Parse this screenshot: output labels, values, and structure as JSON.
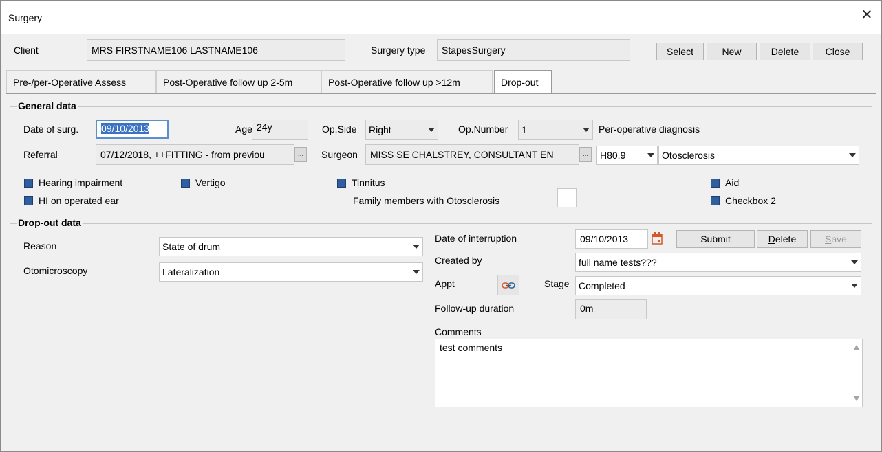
{
  "window": {
    "title": "Surgery",
    "close_glyph": "✕"
  },
  "header": {
    "client_label": "Client",
    "client_value": "MRS FIRSTNAME106 LASTNAME106",
    "surgery_type_label": "Surgery type",
    "surgery_type_value": "StapesSurgery",
    "buttons": {
      "select_pre": "Se",
      "select_u": "l",
      "select_post": "ect",
      "new_u": "N",
      "new_post": "ew",
      "delete": "Delete",
      "close": "Close"
    }
  },
  "tabs": [
    {
      "label": "Pre-/per-Operative Assess"
    },
    {
      "label": "Post-Operative follow up 2-5m"
    },
    {
      "label": "Post-Operative follow up >12m"
    },
    {
      "label": "Drop-out"
    }
  ],
  "general": {
    "title": "General data",
    "date_label": "Date of surg.",
    "date_value": "09/10/2013",
    "age_label": "Age",
    "age_value": "24y",
    "op_side_label": "Op.Side",
    "op_side_value": "Right",
    "op_number_label": "Op.Number",
    "op_number_value": "1",
    "perop_diag_label": "Per-operative diagnosis",
    "referral_label": "Referral",
    "referral_value": "07/12/2018, ++FITTING - from previou",
    "surgeon_label": "Surgeon",
    "surgeon_value": "MISS SE CHALSTREY, CONSULTANT EN",
    "diag_code": "H80.9",
    "diag_value": "Otosclerosis",
    "ellipsis": "...",
    "checks": {
      "hearing_impairment": "Hearing impairment",
      "vertigo": "Vertigo",
      "tinnitus": "Tinnitus",
      "aid": "Aid",
      "hi_operated_ear": "HI on operated ear",
      "family_members": "Family members with Otosclerosis",
      "checkbox2": "Checkbox 2"
    }
  },
  "dropout": {
    "title": "Drop-out data",
    "reason_label": "Reason",
    "reason_value": "State of drum",
    "otomicroscopy_label": "Otomicroscopy",
    "otomicroscopy_value": "Lateralization",
    "date_interruption_label": "Date of interruption",
    "date_interruption_value": "09/10/2013",
    "submit": "Submit",
    "delete_u": "D",
    "delete_post": "elete",
    "save_u": "S",
    "save_post": "ave",
    "created_by_label": "Created by",
    "created_by_value": "full name tests???",
    "appt_label": "Appt",
    "stage_label": "Stage",
    "stage_value": "Completed",
    "followup_label": "Follow-up duration",
    "followup_value": "0m",
    "comments_label": "Comments",
    "comments_value": "test comments"
  }
}
